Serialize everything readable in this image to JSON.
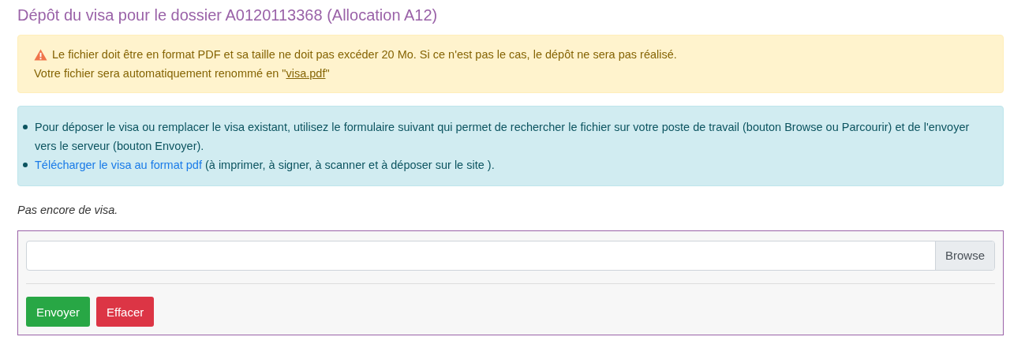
{
  "title": "Dépôt du visa pour le dossier A0120113368 (Allocation A12)",
  "warning": {
    "line1": "Le fichier doit être en format PDF et sa taille ne doit pas excéder 20 Mo. Si ce n'est pas le cas, le dépôt ne sera pas réalisé.",
    "line2_before": "Votre fichier sera automatiquement renommé en \"",
    "line2_link": "visa.pdf",
    "line2_after": "\""
  },
  "info_items": [
    {
      "text": "Pour déposer le visa ou remplacer le visa existant, utilisez le formulaire suivant qui permet de rechercher le fichier sur votre poste de travail (bouton Browse ou Parcourir) et de l'envoyer vers le serveur (bouton Envoyer)."
    },
    {
      "link": "Télécharger le visa au format pdf",
      "text": "(à imprimer, à signer, à scanner et à déposer sur le site )."
    }
  ],
  "status": "Pas encore de visa.",
  "file_field": {
    "button": "Browse"
  },
  "buttons": [
    {
      "label": "Envoyer",
      "kind": "success"
    },
    {
      "label": "Effacer",
      "kind": "danger"
    }
  ]
}
